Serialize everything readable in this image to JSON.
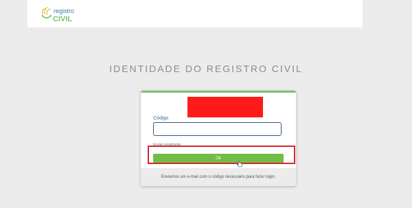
{
  "header": {
    "logo": {
      "text_top": "registro",
      "text_bottom": "CIVIL",
      "icon": "hand-logo-icon"
    }
  },
  "page": {
    "title": "IDENTIDADE DO REGISTRO CIVIL"
  },
  "form": {
    "code_label": "Código",
    "code_value": "",
    "resend_link": "Enviar novamente",
    "ok_button": "Ok",
    "footer_text": "Enviamos um e-mail com o código necessário para fazer login."
  },
  "colors": {
    "accent_green": "#71bd47",
    "input_border": "#34597a",
    "label_blue": "#2f6f95",
    "highlight_red": "#d7262e",
    "redaction_red": "#ff1a1a"
  }
}
